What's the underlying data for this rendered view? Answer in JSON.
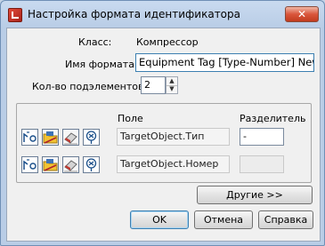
{
  "window": {
    "title": "Настройка формата идентификатора",
    "close_label": "✕"
  },
  "class_row": {
    "label": "Класс:",
    "value": "Компрессор"
  },
  "format_row": {
    "label": "Имя формата:",
    "value": "Equipment Tag [Type-Number] New"
  },
  "subelements_row": {
    "label": "Кол-во подэлементов:",
    "value": "2"
  },
  "table": {
    "field_header": "Поле",
    "separator_header": "Разделитель",
    "rows": [
      {
        "field": "TargetObject.Тип",
        "separator": "-"
      },
      {
        "field": "TargetObject.Номер",
        "separator": ""
      }
    ]
  },
  "buttons": {
    "more": "Другие >>",
    "ok": "OK",
    "cancel": "Отмена",
    "help": "Справка"
  },
  "icons": [
    "properties-icon",
    "folder-icon",
    "eraser-icon",
    "function-icon"
  ]
}
